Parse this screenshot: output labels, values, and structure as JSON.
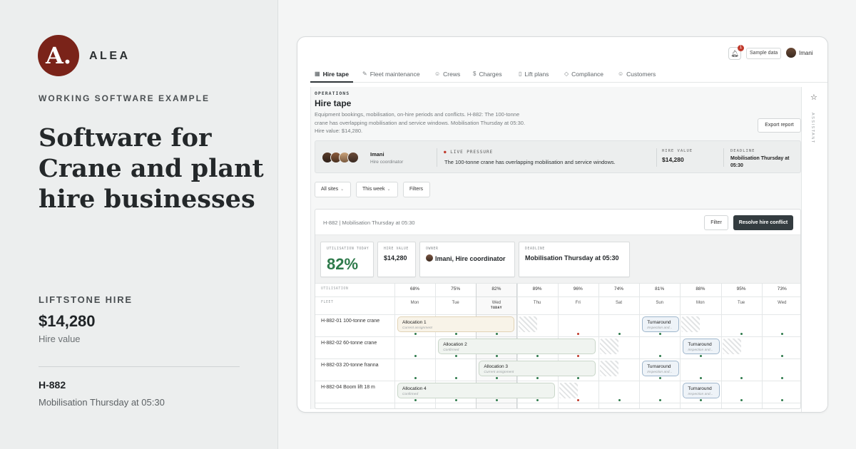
{
  "promo": {
    "logo_letter": "A.",
    "brand": "ALEA",
    "eyebrow": "WORKING SOFTWARE EXAMPLE",
    "headline": "Software for Crane and plant hire businesses",
    "company": "LIFTSTONE HIRE",
    "value": "$14,280",
    "value_label": "Hire value",
    "ref": "H-882",
    "ref_detail": "Mobilisation Thursday at 05:30"
  },
  "topbar": {
    "notification_count": "1",
    "sample_label": "Sample data",
    "user_name": "Imani"
  },
  "tabs": [
    {
      "label": "Hire tape",
      "icon": "calendar-icon",
      "glyph": "▦"
    },
    {
      "label": "Fleet maintenance",
      "icon": "wrench-icon",
      "glyph": "✎"
    },
    {
      "label": "Crews",
      "icon": "users-icon",
      "glyph": "☺"
    },
    {
      "label": "Charges",
      "icon": "dollar-icon",
      "glyph": "$"
    },
    {
      "label": "Lift plans",
      "icon": "document-icon",
      "glyph": "▯"
    },
    {
      "label": "Compliance",
      "icon": "shield-icon",
      "glyph": "◇"
    },
    {
      "label": "Customers",
      "icon": "user-icon",
      "glyph": "☺"
    }
  ],
  "page": {
    "section": "OPERATIONS",
    "title": "Hire tape",
    "description": "Equipment bookings, mobilisation, on-hire periods and conflicts. H-882: The 100-tonne crane has overlapping mobilisation and service windows. Mobilisation Thursday at 05:30. Hire value: $14,280.",
    "export_label": "Export report"
  },
  "pressure": {
    "name": "Imani",
    "role": "Hire coordinator",
    "live_label": "LIVE PRESSURE",
    "message": "The 100-tonne crane has overlapping mobilisation and service windows.",
    "hire_value_label": "HIRE VALUE",
    "hire_value": "$14,280",
    "deadline_label": "DEADLINE",
    "deadline": "Mobilisation Thursday at 05:30"
  },
  "filters": {
    "sites": "All sites",
    "week": "This week",
    "filters": "Filters"
  },
  "board": {
    "title": "H-882 | Mobilisation Thursday at 05:30",
    "filter_label": "Filter",
    "resolve_label": "Resolve hire conflict",
    "cards": {
      "util_label": "UTILISATION TODAY",
      "util_value": "82%",
      "hire_label": "HIRE VALUE",
      "hire_value": "$14,280",
      "owner_label": "OWNER",
      "owner_value": "Imani, Hire coordinator",
      "deadline_label": "DEADLINE",
      "deadline_value": "Mobilisation Thursday at 05:30"
    },
    "util_row_label": "UTILISATION",
    "fleet_label": "FLEET",
    "today_label": "TODAY",
    "days": [
      {
        "pct": "68%",
        "day": "Mon"
      },
      {
        "pct": "75%",
        "day": "Tue"
      },
      {
        "pct": "82%",
        "day": "Wed"
      },
      {
        "pct": "89%",
        "day": "Thu"
      },
      {
        "pct": "96%",
        "day": "Fri"
      },
      {
        "pct": "74%",
        "day": "Sat"
      },
      {
        "pct": "81%",
        "day": "Sun"
      },
      {
        "pct": "88%",
        "day": "Mon"
      },
      {
        "pct": "95%",
        "day": "Tue"
      },
      {
        "pct": "73%",
        "day": "Wed"
      }
    ],
    "fleet": [
      {
        "name": "H-882-01 100-tonne crane"
      },
      {
        "name": "H-882-02 60-tonne crane"
      },
      {
        "name": "H-882-03 20-tonne franna"
      },
      {
        "name": "H-882-04 Boom lift 18 m"
      }
    ],
    "allocations": [
      {
        "label": "Allocation 1",
        "sub": "Current assignment"
      },
      {
        "label": "Turnaround",
        "sub": "Inspection and..."
      },
      {
        "label": "Allocation 2",
        "sub": "Confirmed"
      },
      {
        "label": "Turnaround",
        "sub": "Inspection and..."
      },
      {
        "label": "Allocation 3",
        "sub": "Current assignment"
      },
      {
        "label": "Turnaround",
        "sub": "Inspection and..."
      },
      {
        "label": "Allocation 4",
        "sub": "Confirmed"
      },
      {
        "label": "Turnaround",
        "sub": "Inspection and..."
      }
    ]
  },
  "assistant_label": "ASSISTANT",
  "colors": {
    "brand": "#7a2319",
    "accent_green": "#2e7a4b",
    "alert_red": "#c0392b",
    "primary_button": "#343c40"
  }
}
